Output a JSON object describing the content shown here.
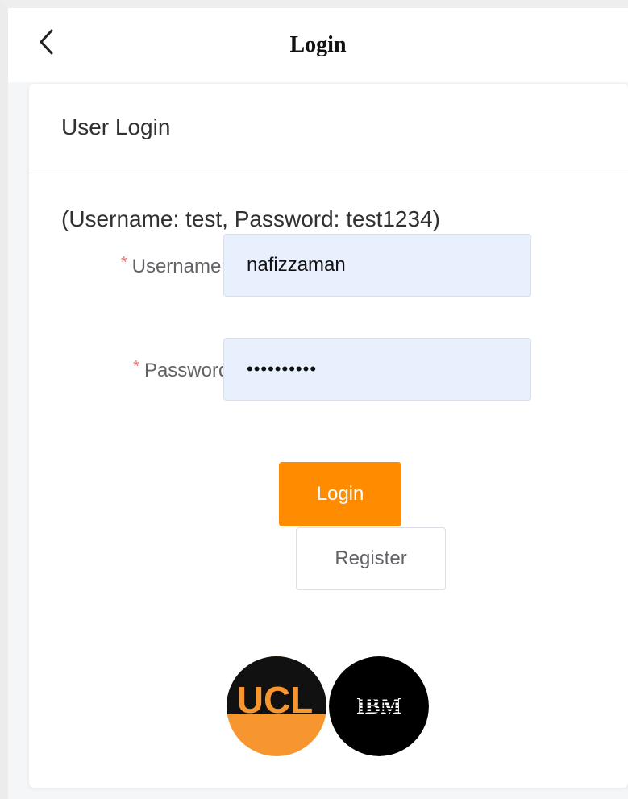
{
  "header": {
    "title": "Login"
  },
  "card": {
    "title": "User Login",
    "hint": "(Username: test, Password: test1234)"
  },
  "form": {
    "username": {
      "label": "Username:",
      "required_mark": "*",
      "value": "nafizzaman"
    },
    "password": {
      "label": "Password:",
      "required_mark": "*",
      "value": "••••••••••"
    }
  },
  "buttons": {
    "login_label": "Login",
    "register_label": "Register"
  },
  "logos": {
    "ucl_text": "UCL",
    "ibm_text": "IBM"
  },
  "colors": {
    "accent": "#ff8c00",
    "input_bg": "#e8f0fe",
    "required": "#f56c6c"
  },
  "icons": {
    "back": "chevron-left-icon"
  }
}
